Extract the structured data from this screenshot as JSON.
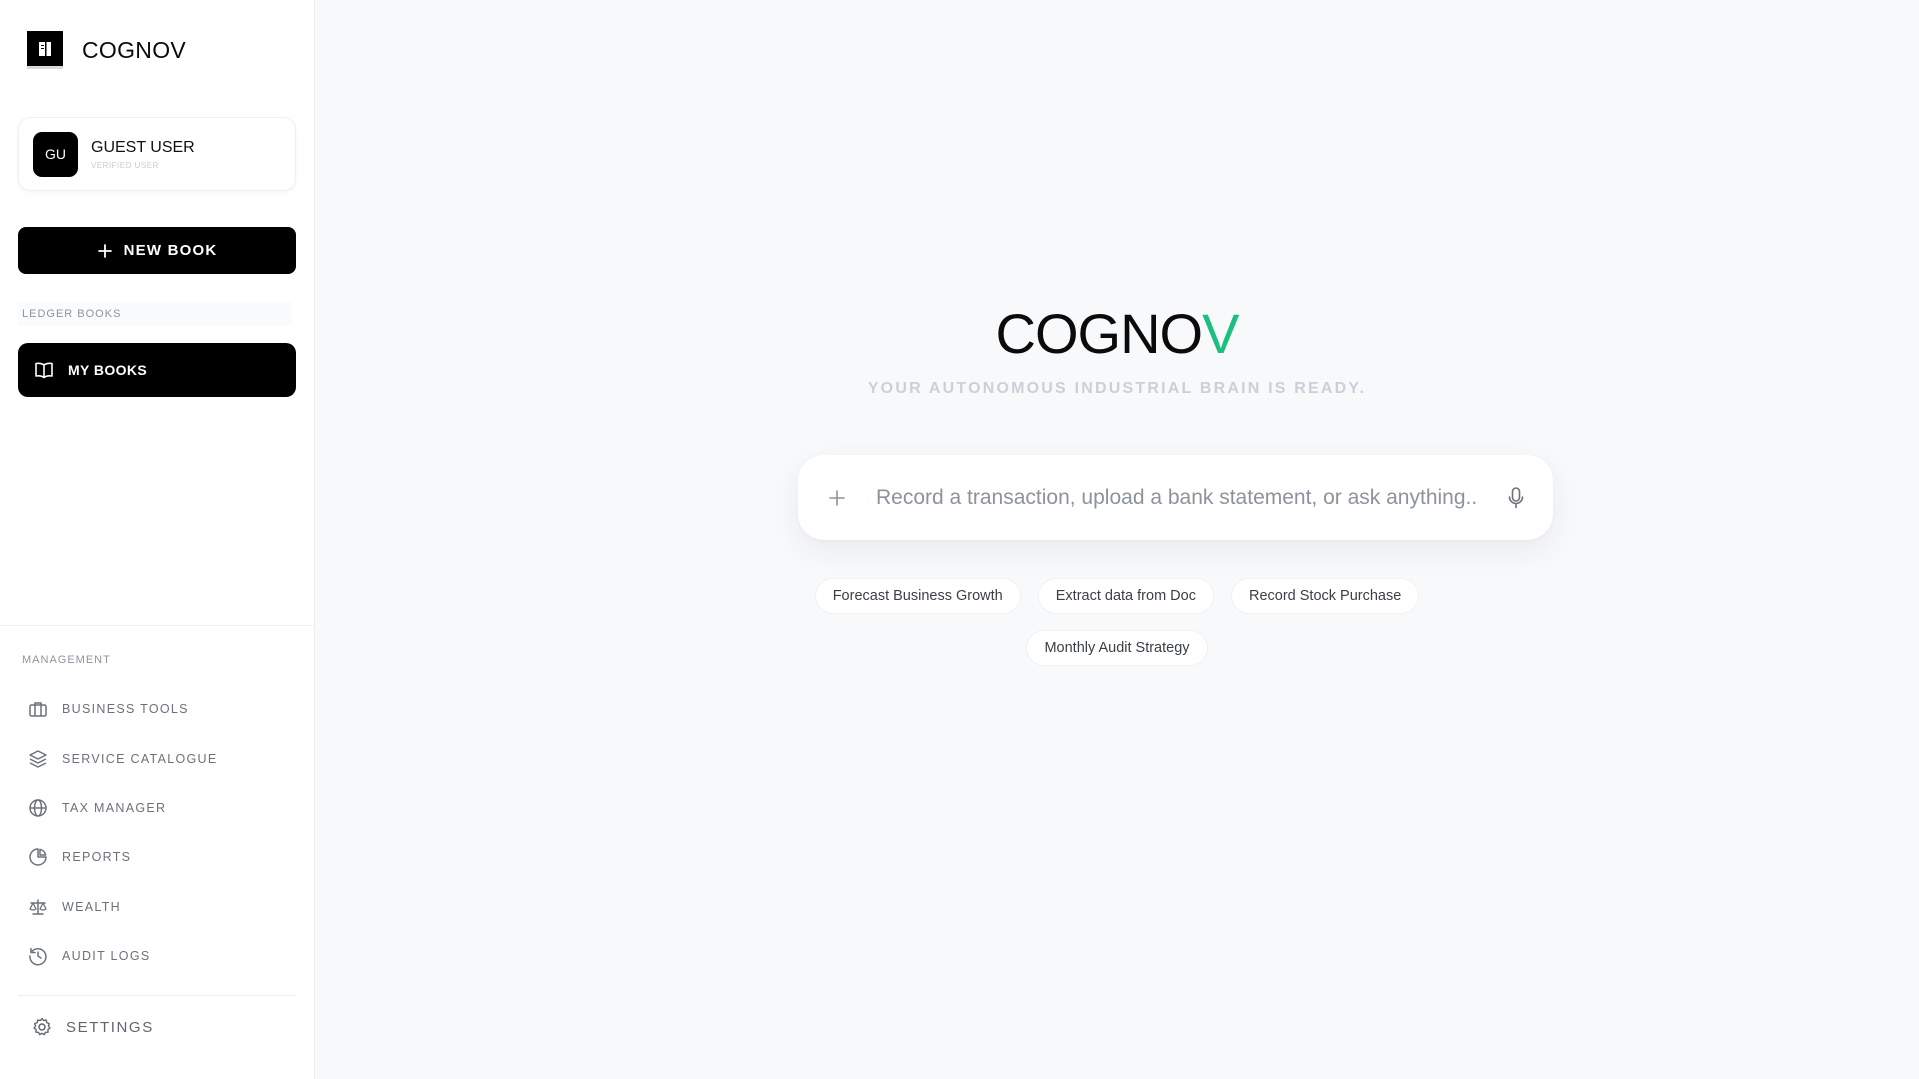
{
  "brand": {
    "name": "COGNOV"
  },
  "user": {
    "initials": "GU",
    "name": "GUEST USER",
    "role": "VERIFIED USER"
  },
  "sidebar": {
    "new_book_label": "NEW BOOK",
    "ledger_section_label": "LEDGER BOOKS",
    "my_books_label": "MY BOOKS",
    "management_label": "MANAGEMENT",
    "nav_items": [
      {
        "label": "BUSINESS TOOLS",
        "icon": "briefcase-icon"
      },
      {
        "label": "SERVICE CATALOGUE",
        "icon": "layers-icon"
      },
      {
        "label": "TAX MANAGER",
        "icon": "globe-icon"
      },
      {
        "label": "REPORTS",
        "icon": "pie-chart-icon"
      },
      {
        "label": "WEALTH",
        "icon": "scale-icon"
      },
      {
        "label": "AUDIT LOGS",
        "icon": "history-icon"
      }
    ],
    "settings_label": "SETTINGS"
  },
  "main": {
    "title_main": "COGNO",
    "title_accent": "V",
    "subtitle": "YOUR AUTONOMOUS INDUSTRIAL BRAIN IS READY.",
    "search_placeholder": "Record a transaction, upload a bank statement, or ask anything...",
    "suggestions": [
      "Forecast Business Growth",
      "Extract data from Doc",
      "Record Stock Purchase",
      "Monthly Audit Strategy"
    ]
  },
  "colors": {
    "accent": "#1dbf7f",
    "primary": "#000000",
    "background": "#f8f9fb"
  }
}
